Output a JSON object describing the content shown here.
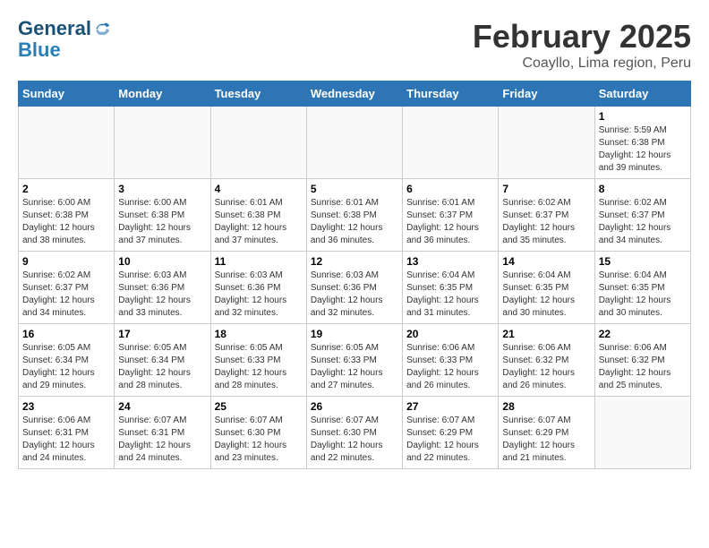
{
  "header": {
    "logo_line1": "General",
    "logo_line2": "Blue",
    "title": "February 2025",
    "subtitle": "Coayllo, Lima region, Peru"
  },
  "weekdays": [
    "Sunday",
    "Monday",
    "Tuesday",
    "Wednesday",
    "Thursday",
    "Friday",
    "Saturday"
  ],
  "weeks": [
    [
      {
        "day": "",
        "info": ""
      },
      {
        "day": "",
        "info": ""
      },
      {
        "day": "",
        "info": ""
      },
      {
        "day": "",
        "info": ""
      },
      {
        "day": "",
        "info": ""
      },
      {
        "day": "",
        "info": ""
      },
      {
        "day": "1",
        "info": "Sunrise: 5:59 AM\nSunset: 6:38 PM\nDaylight: 12 hours\nand 39 minutes."
      }
    ],
    [
      {
        "day": "2",
        "info": "Sunrise: 6:00 AM\nSunset: 6:38 PM\nDaylight: 12 hours\nand 38 minutes."
      },
      {
        "day": "3",
        "info": "Sunrise: 6:00 AM\nSunset: 6:38 PM\nDaylight: 12 hours\nand 37 minutes."
      },
      {
        "day": "4",
        "info": "Sunrise: 6:01 AM\nSunset: 6:38 PM\nDaylight: 12 hours\nand 37 minutes."
      },
      {
        "day": "5",
        "info": "Sunrise: 6:01 AM\nSunset: 6:38 PM\nDaylight: 12 hours\nand 36 minutes."
      },
      {
        "day": "6",
        "info": "Sunrise: 6:01 AM\nSunset: 6:37 PM\nDaylight: 12 hours\nand 36 minutes."
      },
      {
        "day": "7",
        "info": "Sunrise: 6:02 AM\nSunset: 6:37 PM\nDaylight: 12 hours\nand 35 minutes."
      },
      {
        "day": "8",
        "info": "Sunrise: 6:02 AM\nSunset: 6:37 PM\nDaylight: 12 hours\nand 34 minutes."
      }
    ],
    [
      {
        "day": "9",
        "info": "Sunrise: 6:02 AM\nSunset: 6:37 PM\nDaylight: 12 hours\nand 34 minutes."
      },
      {
        "day": "10",
        "info": "Sunrise: 6:03 AM\nSunset: 6:36 PM\nDaylight: 12 hours\nand 33 minutes."
      },
      {
        "day": "11",
        "info": "Sunrise: 6:03 AM\nSunset: 6:36 PM\nDaylight: 12 hours\nand 32 minutes."
      },
      {
        "day": "12",
        "info": "Sunrise: 6:03 AM\nSunset: 6:36 PM\nDaylight: 12 hours\nand 32 minutes."
      },
      {
        "day": "13",
        "info": "Sunrise: 6:04 AM\nSunset: 6:35 PM\nDaylight: 12 hours\nand 31 minutes."
      },
      {
        "day": "14",
        "info": "Sunrise: 6:04 AM\nSunset: 6:35 PM\nDaylight: 12 hours\nand 30 minutes."
      },
      {
        "day": "15",
        "info": "Sunrise: 6:04 AM\nSunset: 6:35 PM\nDaylight: 12 hours\nand 30 minutes."
      }
    ],
    [
      {
        "day": "16",
        "info": "Sunrise: 6:05 AM\nSunset: 6:34 PM\nDaylight: 12 hours\nand 29 minutes."
      },
      {
        "day": "17",
        "info": "Sunrise: 6:05 AM\nSunset: 6:34 PM\nDaylight: 12 hours\nand 28 minutes."
      },
      {
        "day": "18",
        "info": "Sunrise: 6:05 AM\nSunset: 6:33 PM\nDaylight: 12 hours\nand 28 minutes."
      },
      {
        "day": "19",
        "info": "Sunrise: 6:05 AM\nSunset: 6:33 PM\nDaylight: 12 hours\nand 27 minutes."
      },
      {
        "day": "20",
        "info": "Sunrise: 6:06 AM\nSunset: 6:33 PM\nDaylight: 12 hours\nand 26 minutes."
      },
      {
        "day": "21",
        "info": "Sunrise: 6:06 AM\nSunset: 6:32 PM\nDaylight: 12 hours\nand 26 minutes."
      },
      {
        "day": "22",
        "info": "Sunrise: 6:06 AM\nSunset: 6:32 PM\nDaylight: 12 hours\nand 25 minutes."
      }
    ],
    [
      {
        "day": "23",
        "info": "Sunrise: 6:06 AM\nSunset: 6:31 PM\nDaylight: 12 hours\nand 24 minutes."
      },
      {
        "day": "24",
        "info": "Sunrise: 6:07 AM\nSunset: 6:31 PM\nDaylight: 12 hours\nand 24 minutes."
      },
      {
        "day": "25",
        "info": "Sunrise: 6:07 AM\nSunset: 6:30 PM\nDaylight: 12 hours\nand 23 minutes."
      },
      {
        "day": "26",
        "info": "Sunrise: 6:07 AM\nSunset: 6:30 PM\nDaylight: 12 hours\nand 22 minutes."
      },
      {
        "day": "27",
        "info": "Sunrise: 6:07 AM\nSunset: 6:29 PM\nDaylight: 12 hours\nand 22 minutes."
      },
      {
        "day": "28",
        "info": "Sunrise: 6:07 AM\nSunset: 6:29 PM\nDaylight: 12 hours\nand 21 minutes."
      },
      {
        "day": "",
        "info": ""
      }
    ]
  ]
}
